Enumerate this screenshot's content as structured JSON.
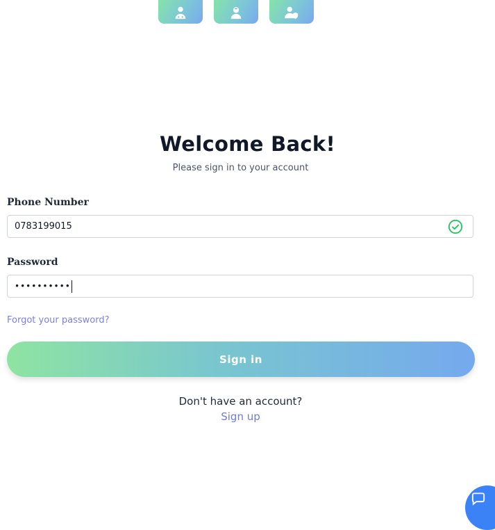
{
  "roles": [
    {
      "icon": "doctor-icon"
    },
    {
      "icon": "nurse-icon"
    },
    {
      "icon": "admin-shield-icon"
    }
  ],
  "header": {
    "title": "Welcome Back!",
    "subtitle": "Please sign in to your account"
  },
  "form": {
    "phone_label": "Phone Number",
    "phone_value": "0783199015",
    "password_label": "Password",
    "password_value": "••••••••••",
    "forgot_link": "Forgot your password?",
    "submit_label": "Sign in"
  },
  "footer": {
    "no_account_text": "Don't have an account?",
    "signup_link": "Sign up"
  },
  "colors": {
    "accent_link": "#7c7fe0",
    "button_gradient_start": "#8ee4a2",
    "button_gradient_end": "#75a9ee",
    "valid_check": "#22c55e",
    "chat_button": "#3b82f6"
  }
}
